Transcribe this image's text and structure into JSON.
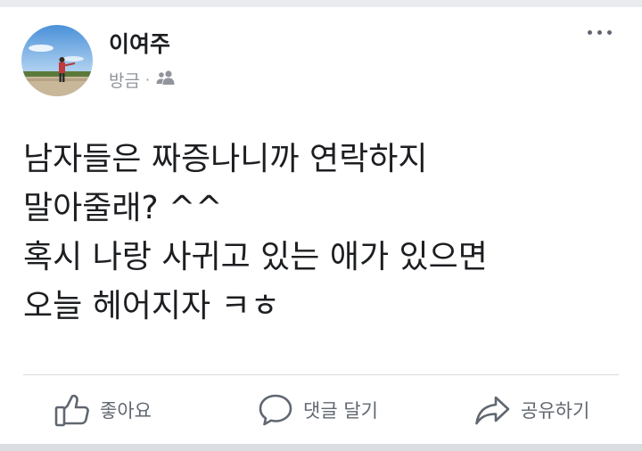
{
  "post": {
    "author": "이여주",
    "meta": {
      "time": "방금",
      "separator": "·",
      "privacy_icon": "friends-icon"
    },
    "body_lines": [
      "남자들은 짜증나니까 연락하지",
      "말아줄래? ^^",
      "혹시 나랑 사귀고 있는 애가 있으면",
      "오늘 헤어지자 ㅋㅎ"
    ],
    "actions": {
      "like": "좋아요",
      "comment": "댓글 달기",
      "share": "공유하기"
    }
  },
  "colors": {
    "text": "#1c1e21",
    "secondary": "#606770",
    "muted": "#90949c",
    "divider": "#dadde1",
    "background": "#e9ebee"
  }
}
